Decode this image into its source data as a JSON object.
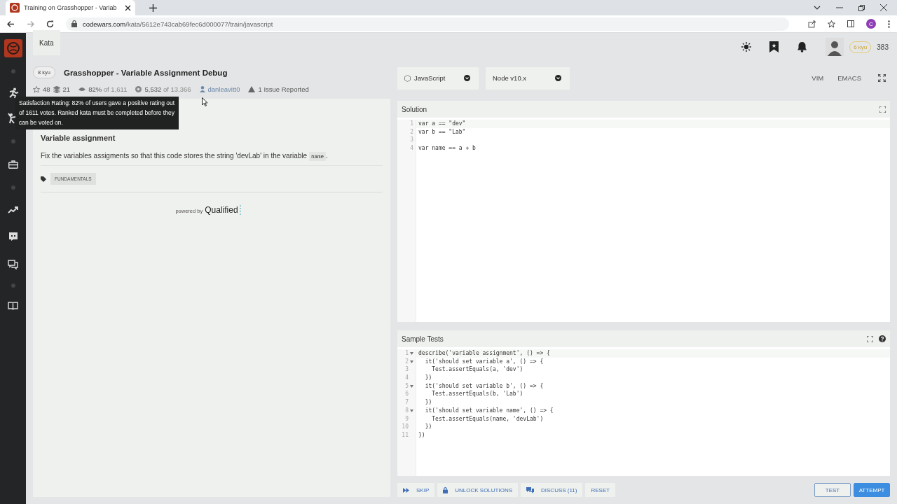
{
  "browser": {
    "tab_title": "Training on Grasshopper - Variab",
    "url_host": "codewars.com",
    "url_path": "/kata/5612e743cab69fec6d000077/train/javascript",
    "profile_initial": "C"
  },
  "sidebar": {
    "items": [
      {
        "kind": "logo"
      },
      {
        "kind": "dot"
      },
      {
        "kind": "runner"
      },
      {
        "kind": "fighter"
      },
      {
        "kind": "dot"
      },
      {
        "kind": "briefcase"
      },
      {
        "kind": "dot"
      },
      {
        "kind": "trend"
      },
      {
        "kind": "chat"
      },
      {
        "kind": "comments"
      },
      {
        "kind": "dot"
      },
      {
        "kind": "book"
      }
    ]
  },
  "topbar": {
    "tab": "Kata",
    "rank": "6 kyu",
    "honor": "383"
  },
  "kata": {
    "rank": "8 kyu",
    "title": "Grasshopper - Variable Assignment Debug",
    "stars": "48",
    "collections": "21",
    "rating": "82%",
    "rating_of": "of 1,611",
    "completed": "5,532",
    "completed_of": "of 13,366",
    "author": "danleavitt0",
    "issues": "1 Issue Reported"
  },
  "tooltip": "Satisfaction Rating: 82% of users gave a positive rating out of 1611 votes. Ranked kata must be completed before they can be voted on.",
  "description": {
    "heading": "Variable assignment",
    "text": "Fix the variables assigments so that this code stores the string 'devLab' in the variable",
    "code": "name",
    "text_end": ".",
    "tags": [
      "FUNDAMENTALS"
    ],
    "powered_by": "powered by",
    "brand": "Qualified"
  },
  "editor_bar": {
    "language": "JavaScript",
    "version": "Node v10.x",
    "modes": [
      "VIM",
      "EMACS"
    ]
  },
  "solution": {
    "title": "Solution",
    "lines": [
      {
        "number": "1",
        "text": "var a == \"dev\""
      },
      {
        "number": "2",
        "text": "var b == \"Lab\""
      },
      {
        "number": "3"
      },
      {
        "number": "4",
        "text": "var name == a + b"
      }
    ]
  },
  "sample_tests": {
    "title": "Sample Tests",
    "lines": [
      {
        "number": "1",
        "text": "describe('variable assignment', () => {",
        "foldable": true
      },
      {
        "number": "2",
        "text": "  it('should set variable a', () => {",
        "foldable": true
      },
      {
        "number": "3",
        "text": "    Test.assertEquals(a, 'dev')",
        "foldable": false
      },
      {
        "number": "4",
        "text": "  })",
        "foldable": false
      },
      {
        "number": "5",
        "text": "  it('should set variable b', () => {",
        "foldable": true
      },
      {
        "number": "6",
        "text": "    Test.assertEquals(b, 'Lab')",
        "foldable": false
      },
      {
        "number": "7",
        "text": "  })",
        "foldable": false
      },
      {
        "number": "8",
        "text": "  it('should set variable name', () => {",
        "foldable": true
      },
      {
        "number": "9",
        "text": "    Test.assertEquals(name, 'devLab')",
        "foldable": false
      },
      {
        "number": "10",
        "text": "  })",
        "foldable": false
      },
      {
        "number": "11",
        "text": "})",
        "foldable": false
      }
    ]
  },
  "actions": [
    {
      "label": "SKIP",
      "kind": "skip"
    },
    {
      "label": "UNLOCK SOLUTIONS",
      "kind": "lock"
    },
    {
      "label": "DISCUSS (11)",
      "kind": "discuss"
    },
    {
      "label": "RESET",
      "kind": "plain"
    }
  ],
  "run_buttons": [
    {
      "label": "TEST",
      "primary": false
    },
    {
      "label": "ATTEMPT",
      "primary": true
    }
  ]
}
